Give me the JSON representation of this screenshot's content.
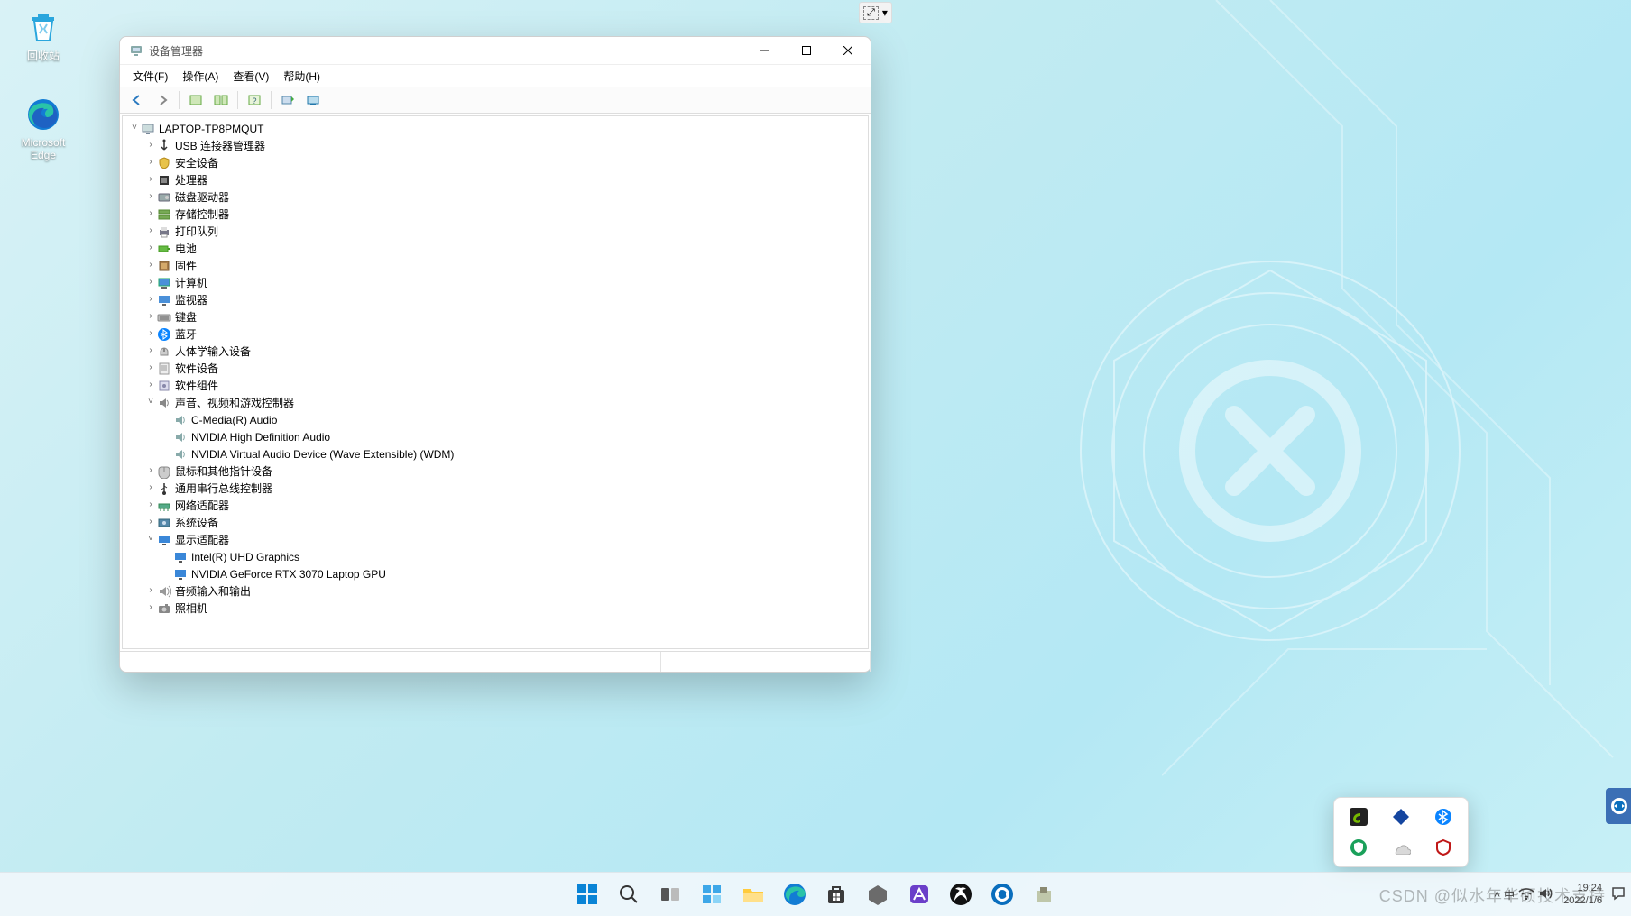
{
  "desktop_icons": [
    {
      "name": "recycle-bin",
      "label": "回收站"
    },
    {
      "name": "microsoft-edge",
      "label": "Microsoft Edge"
    }
  ],
  "helper_toolbar": {
    "icon1": "⤢",
    "icon2": "▾"
  },
  "window": {
    "title": "设备管理器",
    "menus": [
      "文件(F)",
      "操作(A)",
      "查看(V)",
      "帮助(H)"
    ],
    "toolbar_icons": [
      "back",
      "forward",
      "sep",
      "properties-page",
      "properties-window",
      "sep",
      "help",
      "sep",
      "refresh",
      "scan-hardware"
    ],
    "root": "LAPTOP-TP8PMQUT",
    "categories": [
      {
        "icon": "usb",
        "label": "USB 连接器管理器",
        "expanded": false,
        "children": []
      },
      {
        "icon": "security",
        "label": "安全设备",
        "expanded": false,
        "children": []
      },
      {
        "icon": "cpu",
        "label": "处理器",
        "expanded": false,
        "children": []
      },
      {
        "icon": "disk",
        "label": "磁盘驱动器",
        "expanded": false,
        "children": []
      },
      {
        "icon": "storage",
        "label": "存储控制器",
        "expanded": false,
        "children": []
      },
      {
        "icon": "printer",
        "label": "打印队列",
        "expanded": false,
        "children": []
      },
      {
        "icon": "battery",
        "label": "电池",
        "expanded": false,
        "children": []
      },
      {
        "icon": "firmware",
        "label": "固件",
        "expanded": false,
        "children": []
      },
      {
        "icon": "computer",
        "label": "计算机",
        "expanded": false,
        "children": []
      },
      {
        "icon": "monitor",
        "label": "监视器",
        "expanded": false,
        "children": []
      },
      {
        "icon": "keyboard",
        "label": "键盘",
        "expanded": false,
        "children": []
      },
      {
        "icon": "bluetooth",
        "label": "蓝牙",
        "expanded": false,
        "children": []
      },
      {
        "icon": "hid",
        "label": "人体学输入设备",
        "expanded": false,
        "children": []
      },
      {
        "icon": "software",
        "label": "软件设备",
        "expanded": false,
        "children": []
      },
      {
        "icon": "component",
        "label": "软件组件",
        "expanded": false,
        "children": []
      },
      {
        "icon": "sound",
        "label": "声音、视频和游戏控制器",
        "expanded": true,
        "children": [
          {
            "icon": "speaker",
            "label": "C-Media(R) Audio"
          },
          {
            "icon": "speaker",
            "label": "NVIDIA High Definition Audio"
          },
          {
            "icon": "speaker",
            "label": "NVIDIA Virtual Audio Device (Wave Extensible) (WDM)"
          }
        ]
      },
      {
        "icon": "mouse",
        "label": "鼠标和其他指针设备",
        "expanded": false,
        "children": []
      },
      {
        "icon": "usb-ctrl",
        "label": "通用串行总线控制器",
        "expanded": false,
        "children": []
      },
      {
        "icon": "network",
        "label": "网络适配器",
        "expanded": false,
        "children": []
      },
      {
        "icon": "system",
        "label": "系统设备",
        "expanded": false,
        "children": []
      },
      {
        "icon": "display",
        "label": "显示适配器",
        "expanded": true,
        "children": [
          {
            "icon": "display-card",
            "label": "Intel(R) UHD Graphics"
          },
          {
            "icon": "display-card",
            "label": "NVIDIA GeForce RTX 3070 Laptop GPU"
          }
        ]
      },
      {
        "icon": "audio-io",
        "label": "音频输入和输出",
        "expanded": false,
        "children": []
      },
      {
        "icon": "camera",
        "label": "照相机",
        "expanded": false,
        "children": []
      }
    ]
  },
  "tray_popup_icons": [
    "nvidia",
    "unknown-blue",
    "bluetooth",
    "security-green",
    "onedrive",
    "mcafee"
  ],
  "taskbar": {
    "pinned": [
      "start",
      "search",
      "task-view",
      "widgets",
      "file-explorer",
      "edge",
      "microsoft-store",
      "app-grey",
      "app-purple",
      "xbox",
      "teamviewer",
      "app-misc"
    ],
    "right": {
      "tray_chevron": "˄",
      "ime": "中",
      "wifi": "wifi-icon",
      "volume": "volume-icon",
      "clock_time": "19:24",
      "clock_date": "2022/1/6"
    }
  },
  "watermark": "CSDN @似水年华硕技术支持",
  "colors": {
    "accent": "#0a84d6",
    "bluetooth": "#0a84ff",
    "nvidia": "#76b900"
  }
}
